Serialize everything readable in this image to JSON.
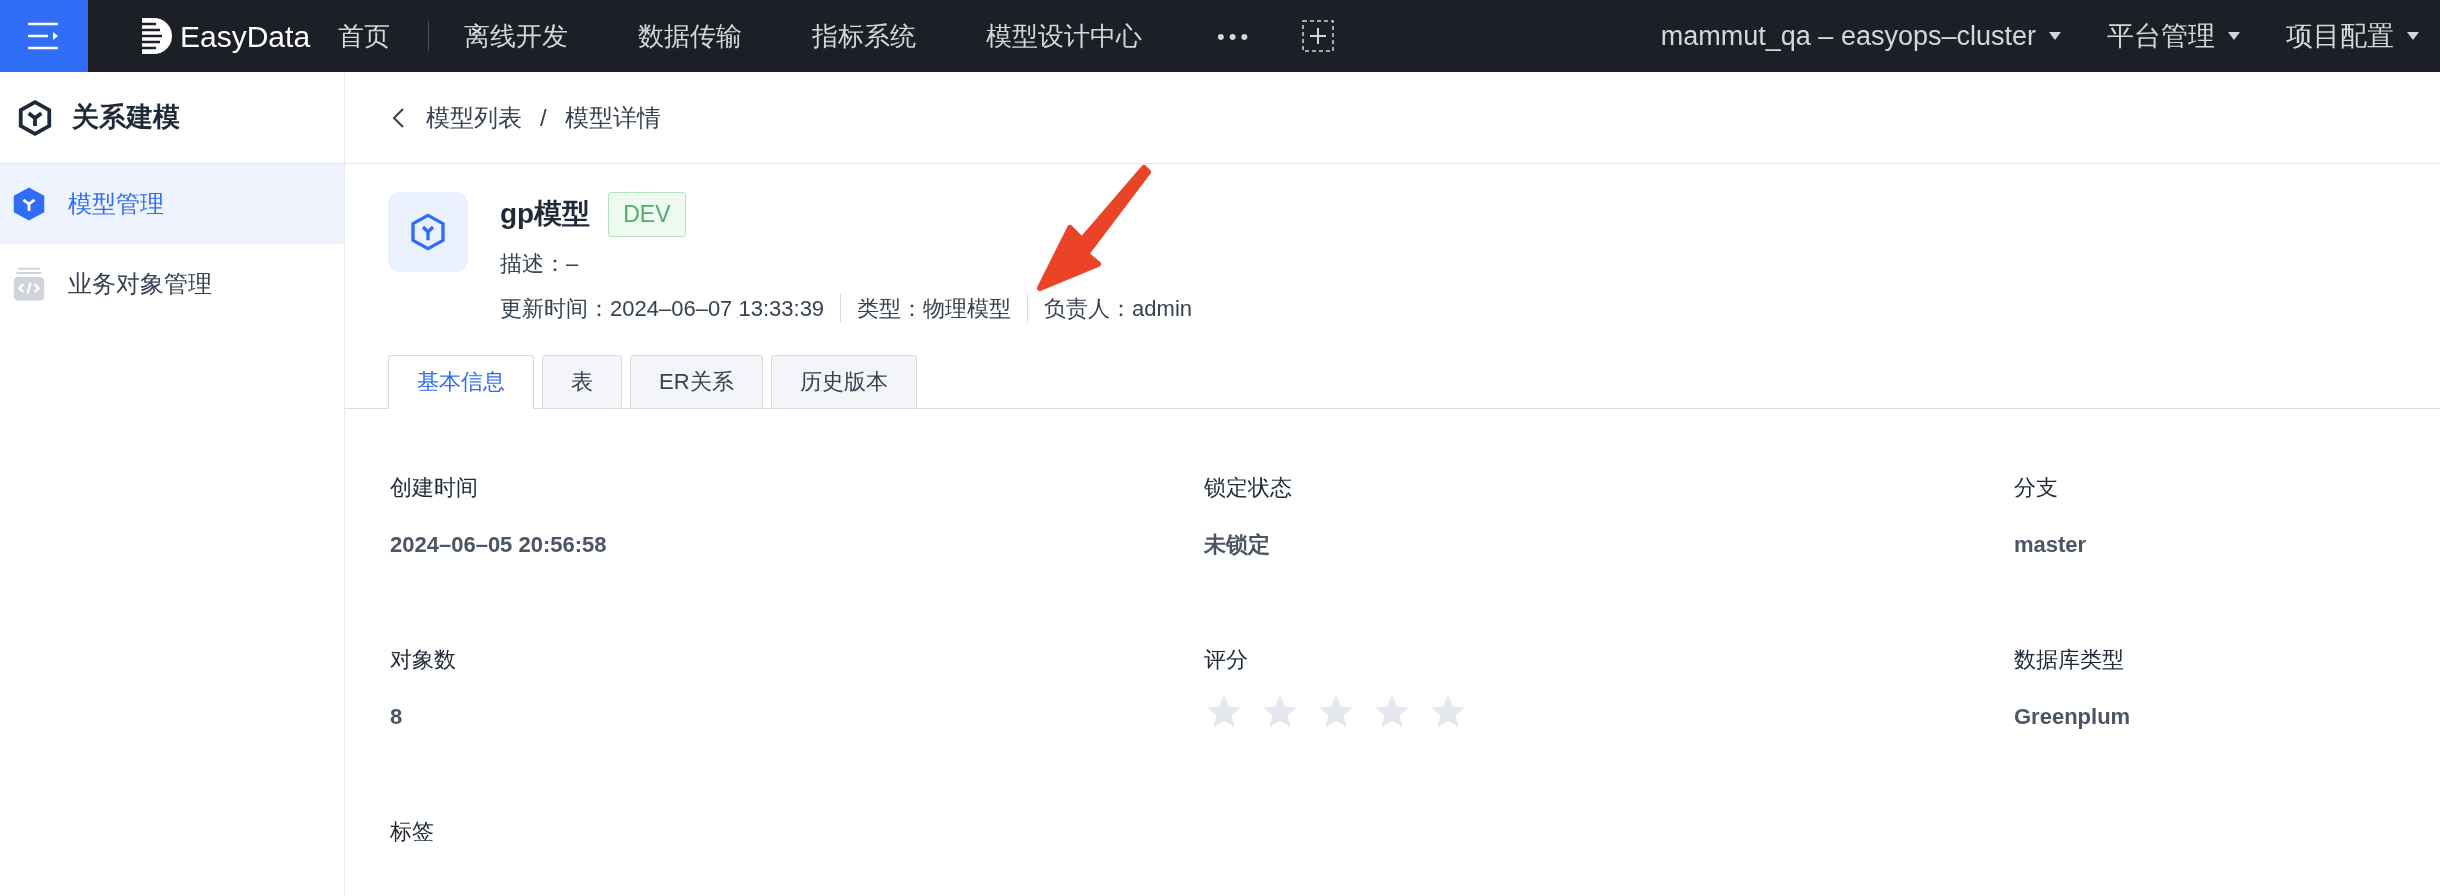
{
  "topbar": {
    "brand": "EasyData",
    "nav": [
      {
        "label": "首页",
        "selected": false
      },
      {
        "label": "离线开发",
        "selected": false
      },
      {
        "label": "数据传输",
        "selected": false
      },
      {
        "label": "指标系统",
        "selected": false
      },
      {
        "label": "模型设计中心",
        "selected": false
      }
    ],
    "more": "•••",
    "menus": [
      "mammut_qa – easyops–cluster",
      "平台管理",
      "项目配置"
    ]
  },
  "sidebar": {
    "title": "关系建模",
    "items": [
      {
        "label": "模型管理",
        "selected": true,
        "kind": "model"
      },
      {
        "label": "业务对象管理",
        "selected": false,
        "kind": "code"
      }
    ]
  },
  "breadcrumb": {
    "separator": "/",
    "items": [
      "模型列表",
      "模型详情"
    ]
  },
  "model": {
    "name": "gp模型",
    "badge": "DEV",
    "description_label": "描述：",
    "description": "–",
    "meta": [
      {
        "label": "更新时间：",
        "value": "2024–06–07 13:33:39"
      },
      {
        "label": "类型：",
        "value": "物理模型"
      },
      {
        "label": "负责人：",
        "value": "admin"
      }
    ]
  },
  "tabs": [
    {
      "label": "基本信息",
      "selected": true
    },
    {
      "label": "表",
      "selected": false
    },
    {
      "label": "ER关系",
      "selected": false
    },
    {
      "label": "历史版本",
      "selected": false
    }
  ],
  "fields": [
    {
      "label": "创建时间",
      "kind": "text",
      "value": "2024–06–05 20:56:58"
    },
    {
      "label": "锁定状态",
      "kind": "text",
      "value": "未锁定"
    },
    {
      "label": "分支",
      "kind": "text",
      "value": "master"
    },
    {
      "label": "对象数",
      "kind": "text",
      "value": "8"
    },
    {
      "label": "评分",
      "kind": "stars",
      "stars": 0
    },
    {
      "label": "数据库类型",
      "kind": "text",
      "value": "Greenplum"
    },
    {
      "label": "标签",
      "kind": "empty"
    }
  ]
}
